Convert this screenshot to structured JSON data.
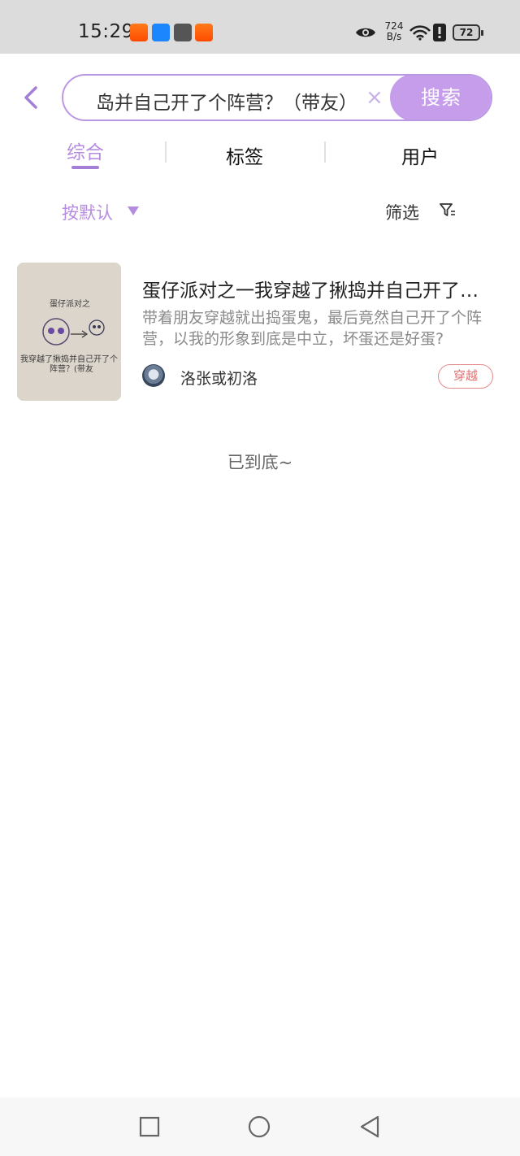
{
  "status_bar": {
    "time": "15:29",
    "net_speed_value": "724",
    "net_speed_unit": "B/s",
    "battery": "72",
    "app_icons": [
      "taobao-icon",
      "weather-icon",
      "calendar-icon",
      "taobao-icon"
    ],
    "right_icons": [
      "eye-icon",
      "wifi-icon",
      "alert-icon",
      "battery-icon"
    ]
  },
  "search": {
    "query": "岛并自己开了个阵营？（带友）",
    "button_label": "搜索",
    "clear_symbol": "×"
  },
  "tabs": [
    {
      "label": "综合",
      "active": true
    },
    {
      "label": "标签",
      "active": false
    },
    {
      "label": "用户",
      "active": false
    }
  ],
  "sort": {
    "label": "按默认",
    "filter_label": "筛选"
  },
  "results": [
    {
      "title": "蛋仔派对之一我穿越了揪捣并自己开了个阵营？（带友）",
      "description": "带着朋友穿越就出捣蛋鬼，最后竟然自己开了个阵营，以我的形象到底是中立，坏蛋还是好蛋?",
      "author": "洛张或初洛",
      "tag": "穿越",
      "thumbnail_text": [
        "蛋仔派对之",
        "我穿越了揪捣并自己开了个",
        "阵营？(带友"
      ]
    }
  ],
  "end_text": "已到底~",
  "colors": {
    "accent": "#c69deb",
    "accent_text": "#b58ce0",
    "tag_border": "#e48a8a",
    "status_bar_bg": "#dcdcdc"
  },
  "nav_buttons": [
    "recent-apps-icon",
    "home-icon",
    "back-icon"
  ]
}
